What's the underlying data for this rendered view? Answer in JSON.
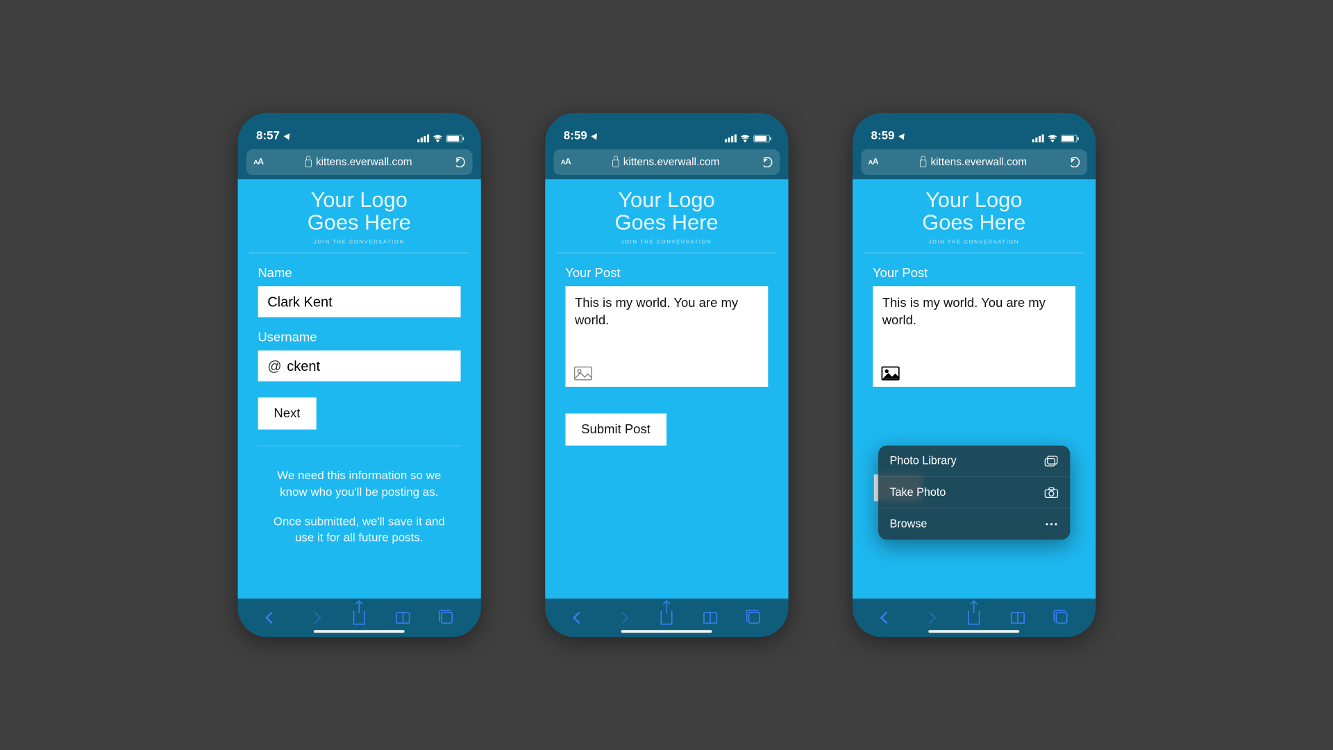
{
  "status": {
    "time1": "8:57",
    "time2": "8:59",
    "time3": "8:59"
  },
  "browser": {
    "aa_label": "AA",
    "url": "kittens.everwall.com"
  },
  "logo": {
    "line1": "Your Logo",
    "line2": "Goes Here",
    "tagline": "JOIN THE CONVERSATION"
  },
  "screen1": {
    "name_label": "Name",
    "name_value": "Clark Kent",
    "user_label": "Username",
    "user_at": "@",
    "user_value": "ckent",
    "next_btn": "Next",
    "info1": "We need this information so we know who you'll be posting as.",
    "info2": "Once submitted, we'll save it and use it for all future posts."
  },
  "screen2": {
    "post_label": "Your Post",
    "post_text": "This is my world. You are my world.",
    "submit_btn": "Submit Post"
  },
  "screen3": {
    "post_label": "Your Post",
    "post_text": "This is my world. You are my world.",
    "menu": {
      "photo_library": "Photo Library",
      "take_photo": "Take Photo",
      "browse": "Browse"
    }
  }
}
